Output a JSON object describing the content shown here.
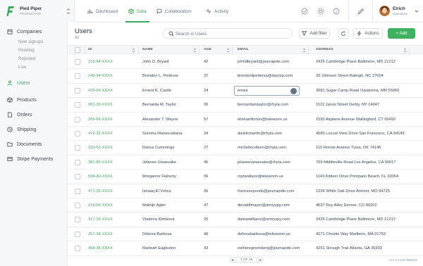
{
  "app": {
    "name": "Pied Piper",
    "environment": "PRODUCTION",
    "brand_color": "#3da55d"
  },
  "nav": {
    "tabs": [
      {
        "label": "Dashboard",
        "icon": "bar-chart-icon"
      },
      {
        "label": "Data",
        "icon": "cube-icon",
        "active": true
      },
      {
        "label": "Collaboration",
        "icon": "chat-icon"
      },
      {
        "label": "Activity",
        "icon": "activity-icon"
      }
    ]
  },
  "user": {
    "name": "Elrich",
    "role": "Operations"
  },
  "sidebar": {
    "items": [
      {
        "label": "Companies",
        "icon": "building-icon"
      },
      {
        "label": "Users",
        "icon": "user-icon",
        "active": true
      },
      {
        "label": "Products",
        "icon": "box-icon"
      },
      {
        "label": "Orders",
        "icon": "document-icon"
      },
      {
        "label": "Shipping",
        "icon": "clock-icon"
      },
      {
        "label": "Documents",
        "icon": "folder-icon"
      },
      {
        "label": "Stripe Payments",
        "icon": "card-icon"
      }
    ],
    "sub_items": [
      "New signups",
      "Pending",
      "Rejected",
      "Live"
    ]
  },
  "page": {
    "title": "Users",
    "subtitle": "All",
    "search_placeholder": "Search in Users",
    "add_filter_label": "Add filter",
    "actions_label": "Actions",
    "add_label": "+ Add"
  },
  "table": {
    "columns": [
      "ID",
      "NAME",
      "AGE",
      "EMAIL",
      "ADDRESS"
    ],
    "rows": [
      {
        "id": "216-44-XXXX",
        "name": "John D. Bryant",
        "age": "42",
        "email": "johndbryant@jourrapide.com",
        "address": "2426 Cambridge Place Baltimore, MD 21212"
      },
      {
        "id": "240-94-XXXX",
        "name": "Brendon L. Pedersa",
        "age": "37",
        "email": "brendonlpedersa@dayrep.com",
        "address": "20 Johnson Street Raleigh, NC 27604"
      },
      {
        "id": "476-66-XXXX",
        "name": "Ernest K. Castle",
        "age": "24",
        "email": "ernes",
        "address": "3081 Sugar Camp Road Owatonna, MN 55060",
        "editing": true
      },
      {
        "id": "061-20-XXXX",
        "name": "Bernarda M. Taylor",
        "age": "36",
        "email": "bernardamtaylor@rhyta.com",
        "address": "1122 Jarvis Street Derby, NY 14047"
      },
      {
        "id": "266-66-XXXX",
        "name": "Alexander T. Wayne",
        "age": "57",
        "email": "elishamforton@teleworm.us",
        "address": "1590 Airplane Avenue Wallingford, CT 06492"
      },
      {
        "id": "472-32-XXXX",
        "name": "Sunstra Maneerattana",
        "age": "34",
        "email": "davidcmartin@rhyta.com",
        "address": "4589 Locust View Drive San Francisco, CA 94143"
      },
      {
        "id": "233-62-XXXX",
        "name": "Darius Cummings",
        "age": "27",
        "email": "michellecoburn@rhyta.com",
        "address": "119 Hornor Avenue Tulsa, OK 74146"
      },
      {
        "id": "381-80-XXXX",
        "name": "Jelanee Uwaesake",
        "age": "45",
        "email": "jelaneeuwaesake@rhyta.com",
        "address": "709 Middleville Road Los Angeles, CA 90017"
      },
      {
        "id": "594-30-XXXX",
        "name": "Morganne Flaherty",
        "age": "36",
        "email": "roytwallace@teleworm.us",
        "address": "1143 Kildeer Drive Pompano Beach, FL 33064"
      },
      {
        "id": "471-39-XXXX",
        "name": "Ishaaq El Vohra",
        "age": "35",
        "email": "francessponds@jourrapide.com",
        "address": "1224 White Oak Drive Amoret, MO 64725"
      },
      {
        "id": "219-06-XXXX",
        "name": "Mathijn Agter",
        "age": "47",
        "email": "donaldfmayer@armyspy.com",
        "address": "4697 Roy Alley Denver, CO 80202"
      },
      {
        "id": "317-16-XXXX",
        "name": "Vladéna Klimková",
        "age": "25",
        "email": "dalewwilliams@armyspy.com",
        "address": "2426 Cambridge Place Baltimore, MD 21212"
      },
      {
        "id": "257-34-XXXX",
        "name": "Débora Barbosa",
        "age": "46",
        "email": "deborabarbosa@teleworm.us",
        "address": "4271 Christie Way Marlboro, MA 01752"
      },
      {
        "id": "458-38-XXXX",
        "name": "Marleah Eagleston",
        "age": "43",
        "email": "estheregreenberg@jourrapide.com",
        "address": "4251 Strough Trail Atlanta, GA 30303"
      }
    ]
  },
  "pagination": {
    "info": "1 OF 16",
    "total": "170 CUSTOMERS"
  }
}
